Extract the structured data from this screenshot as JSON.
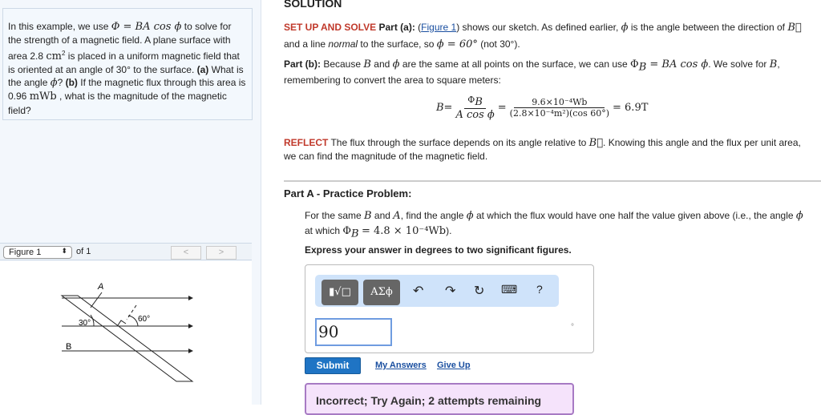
{
  "problem": {
    "t1": "In this example, we use ",
    "eq1": "Φ = BA cos ϕ",
    "t2": " to solve for the strength of a magnetic field. A plane surface with area 2.8 ",
    "cm": "cm",
    "t3": " is placed in a uniform magnetic field that is oriented at an angle of 30° to the surface. ",
    "a": "(a)",
    "t4": " What is the angle ",
    "phi": "ϕ",
    "t5": "? ",
    "b": "(b)",
    "t6": " If the magnetic flux through this area is 0.96 ",
    "mwb": "mWb",
    "t7": " , what is the magnitude of the magnetic field?"
  },
  "figure": {
    "select": "Figure 1",
    "of": "of 1",
    "prev": "<",
    "next": ">",
    "label_A": "A",
    "label_30": "30°",
    "label_60": "60°",
    "label_B": "B"
  },
  "solution": {
    "heading": "SOLUTION",
    "setup": "SET UP AND SOLVE",
    "parta": "Part (a):",
    "link": "Figure 1",
    "s1": ") shows our sketch. As defined earlier, ",
    "s2": " is the angle between the direction of ",
    "s3": " and a line ",
    "normal": "normal",
    "s4": " to the surface, so ",
    "eqphi": "ϕ = 60°",
    "s5": " (not 30°).",
    "partb": "Part (b):",
    "b1": " Because ",
    "b2": " and ",
    "b3": " are the same at all points on the surface, we can use ",
    "eqflux": "Φ",
    "b4": ". We solve for ",
    "b5": ", remembering to convert the area to square meters:",
    "eq_B": "B=",
    "eq_num1": "Φ",
    "eq_den1": "A cos ϕ",
    "eq_num2": "9.6×10⁻⁴Wb",
    "eq_den2": "(2.8×10⁻⁴m²)(cos 60°)",
    "eq_res": "= 6.9T",
    "reflect": "REFLECT",
    "r1": " The flux through the surface depends on its angle relative to ",
    "r2": ". Knowing this angle and the flux per unit area, we can find the magnitude of the magnetic field."
  },
  "practice": {
    "heading": "Part A - Practice Problem:",
    "p1": "For the same ",
    "p2": " and ",
    "p3": ", find the angle ",
    "p4": " at which the flux would have one half the value given above (i.e., the angle ",
    "p5": " at which ",
    "eq": "= 4.8 × 10⁻⁴Wb",
    "p6": ").",
    "instr": "Express your answer in degrees to two significant figures."
  },
  "answer": {
    "templates": "▮√□",
    "greek": "ΑΣϕ",
    "help": "?",
    "value": "90",
    "unit": "°",
    "submit": "Submit",
    "my_answers": "My Answers",
    "give_up": "Give Up",
    "feedback": "Incorrect; Try Again; 2 attempts remaining"
  }
}
